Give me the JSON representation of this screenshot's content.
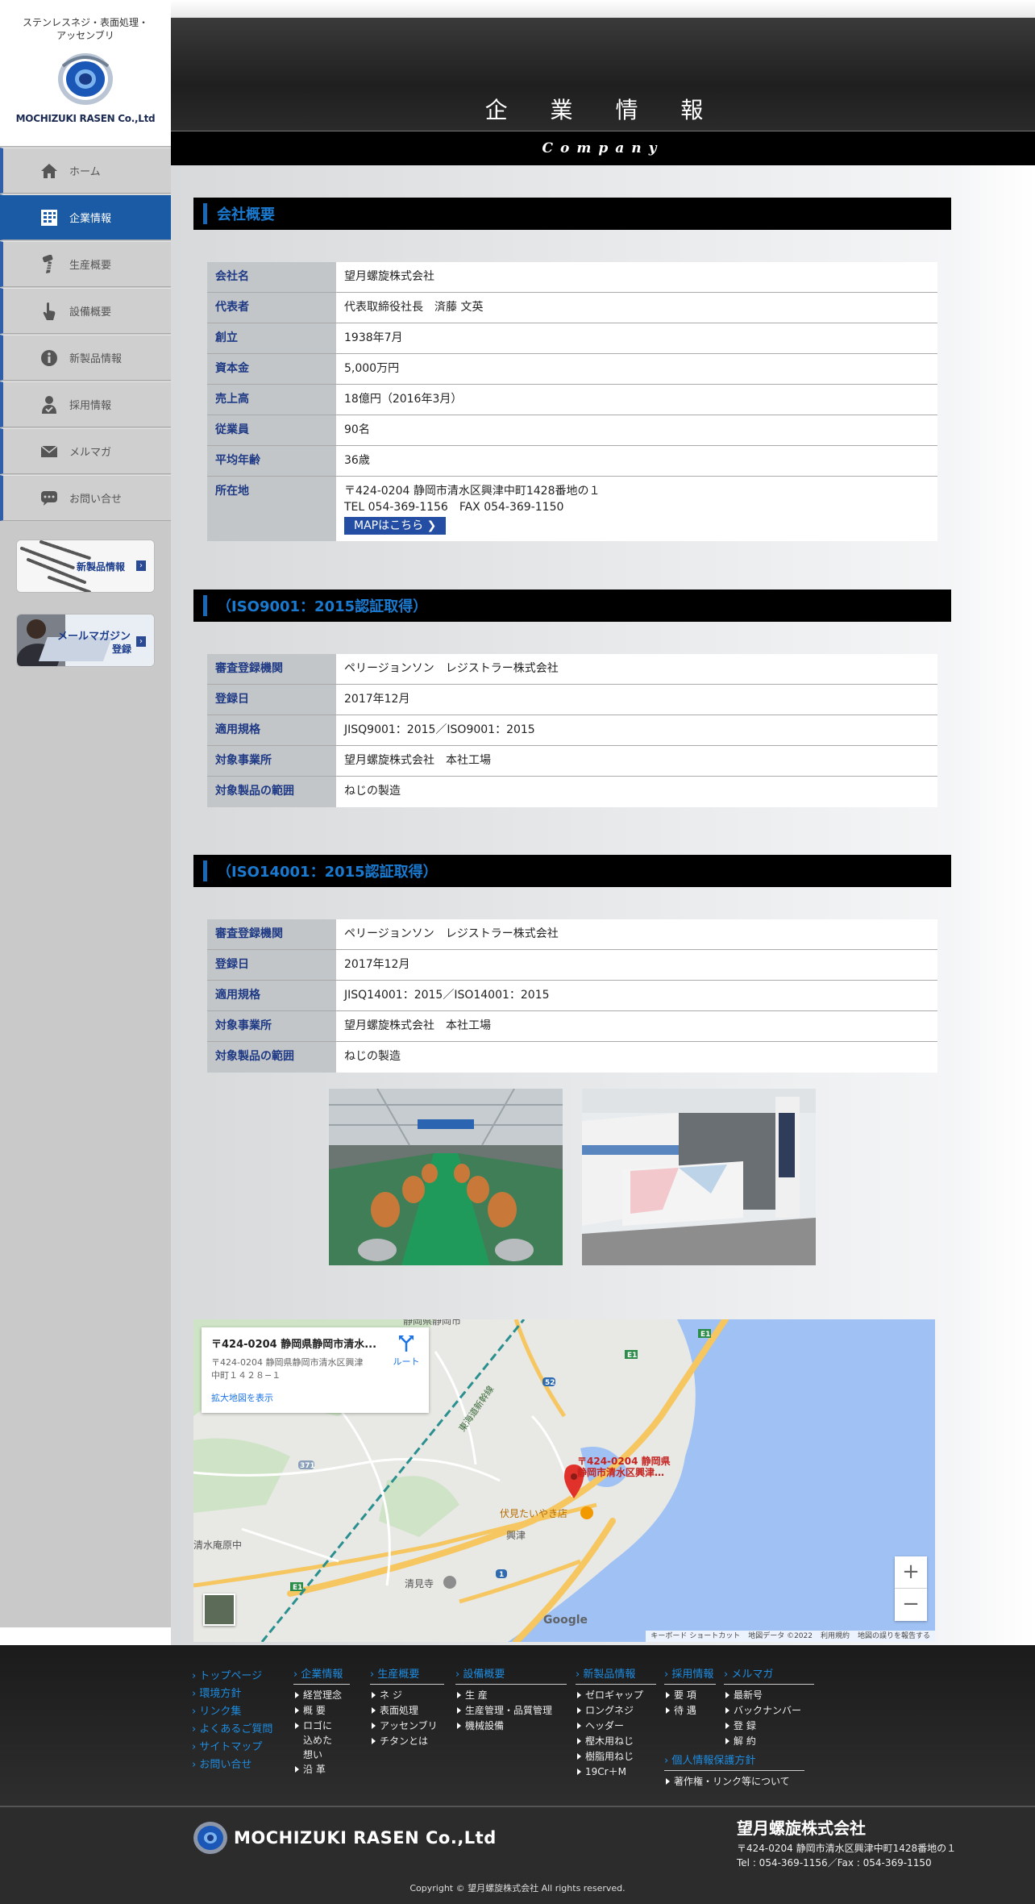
{
  "sidebar": {
    "tagline_line1": "ステンレスネジ・表面処理・",
    "tagline_line2": "アッセンブリ",
    "logo_text": "MOCHIZUKI RASEN Co.,Ltd",
    "nav": [
      {
        "label": "ホーム",
        "icon": "home-icon"
      },
      {
        "label": "企業情報",
        "icon": "building-icon",
        "active": true
      },
      {
        "label": "生産概要",
        "icon": "screw-icon"
      },
      {
        "label": "設備概要",
        "icon": "hand-pointer-icon"
      },
      {
        "label": "新製品情報",
        "icon": "info-icon"
      },
      {
        "label": "採用情報",
        "icon": "user-check-icon"
      },
      {
        "label": "メルマガ",
        "icon": "envelope-icon"
      },
      {
        "label": "お問い合せ",
        "icon": "chat-icon"
      }
    ],
    "banner_products": "新製品情報",
    "banner_mail_line1": "メールマガジン",
    "banner_mail_line2": "登録"
  },
  "header": {
    "title": "企 業 情 報",
    "subtitle": "Company"
  },
  "company": {
    "heading": "会社概要",
    "rows": [
      {
        "k": "会社名",
        "v": "望月螺旋株式会社"
      },
      {
        "k": "代表者",
        "v": "代表取締役社長　済藤 文英"
      },
      {
        "k": "創立",
        "v": "1938年7月"
      },
      {
        "k": "資本金",
        "v": "5,000万円"
      },
      {
        "k": "売上高",
        "v": "18億円（2016年3月）"
      },
      {
        "k": "従業員",
        "v": "90名"
      },
      {
        "k": "平均年齢",
        "v": "36歳"
      }
    ],
    "address_label": "所在地",
    "address": "〒424-0204 静岡市清水区興津中町1428番地の１",
    "tel": "TEL 054-369-1156　FAX 054-369-1150",
    "map_button": "MAPはこちら"
  },
  "iso9001": {
    "heading": "（ISO9001：2015認証取得）",
    "rows": [
      {
        "k": "審査登録機関",
        "v": "ペリージョンソン　レジストラー株式会社"
      },
      {
        "k": "登録日",
        "v": "2017年12月"
      },
      {
        "k": "適用規格",
        "v": "JISQ9001：2015／ISO9001：2015"
      },
      {
        "k": "対象事業所",
        "v": "望月螺旋株式会社　本社工場"
      },
      {
        "k": "対象製品の範囲",
        "v": "ねじの製造"
      }
    ]
  },
  "iso14001": {
    "heading": "（ISO14001：2015認証取得）",
    "rows": [
      {
        "k": "審査登録機関",
        "v": "ペリージョンソン　レジストラー株式会社"
      },
      {
        "k": "登録日",
        "v": "2017年12月"
      },
      {
        "k": "適用規格",
        "v": "JISQ14001：2015／ISO14001：2015"
      },
      {
        "k": "対象事業所",
        "v": "望月螺旋株式会社　本社工場"
      },
      {
        "k": "対象製品の範囲",
        "v": "ねじの製造"
      }
    ]
  },
  "map": {
    "card_title": "〒424-0204 静岡県静岡市清水...",
    "card_addr1": "〒424-0204 静岡県静岡市清水区興津",
    "card_addr2": "中町１４２８−１",
    "route": "ルート",
    "enlarge": "拡大地図を表示",
    "pin_label1": "〒424-0204 静岡県",
    "pin_label2": "静岡市清水区興津…",
    "place_taiyaki": "伏見たいやき店",
    "place_okitsu": "興津",
    "place_seikenji": "清見寺",
    "place_school": "清水庵原中",
    "place_top": "静岡県静岡市",
    "shinkansen": "東海道新幹線",
    "route_e1": "E1",
    "route_52": "52",
    "route_1": "1",
    "route_371": "371",
    "zoom_in": "+",
    "zoom_out": "−",
    "google": "Google",
    "attr1": "キーボード ショートカット",
    "attr2": "地図データ ©2022",
    "attr3": "利用規約",
    "attr4": "地図の誤りを報告する"
  },
  "footer": {
    "left_links": [
      "トップページ",
      "環境方針",
      "リンク集",
      "よくあるご質問",
      "サイトマップ",
      "お問い合せ"
    ],
    "cols": [
      {
        "title": "企業情報",
        "items": [
          "経営理念",
          "概 要",
          "ロゴに込めた想い",
          "沿 革"
        ]
      },
      {
        "title": "生産概要",
        "items": [
          "ネ ジ",
          "表面処理",
          "アッセンブリ",
          "チタンとは"
        ]
      },
      {
        "title": "設備概要",
        "items": [
          "生 産",
          "生産管理・品質管理",
          "機械設備"
        ]
      },
      {
        "title": "新製品情報",
        "items": [
          "ゼロギャップ",
          "ロングネジ",
          "ヘッダー",
          "樫木用ねじ",
          "樹脂用ねじ",
          "19Cr＋M"
        ]
      },
      {
        "title": "採用情報",
        "items": [
          "要 項",
          "待 遇"
        ]
      },
      {
        "title": "メルマガ",
        "items": [
          "最新号",
          "バックナンバー",
          "登 録",
          "解 約"
        ]
      }
    ],
    "privacy_title": "個人情報保護方針",
    "privacy_item": "著作権・リンク等について",
    "logo_text": "MOCHIZUKI RASEN Co.,Ltd",
    "company_name": "望月螺旋株式会社",
    "address": "〒424-0204 静岡市清水区興津中町1428番地の１",
    "tel": "Tel : 054-369-1156／Fax : 054-369-1150",
    "copyright": "Copyright © 望月螺旋株式会社 All rights reserved."
  }
}
